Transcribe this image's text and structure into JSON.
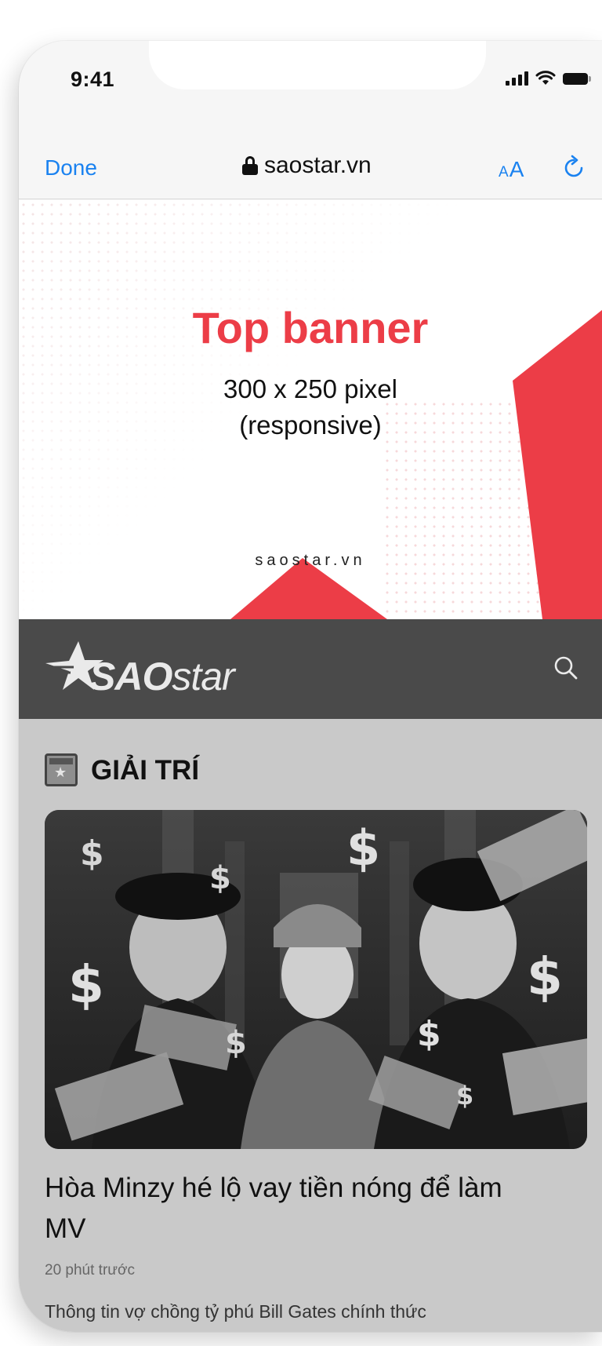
{
  "status_bar": {
    "time": "9:41"
  },
  "browser": {
    "done_label": "Done",
    "url": "saostar.vn",
    "text_size_small": "A",
    "text_size_large": "A"
  },
  "banner": {
    "title": "Top banner",
    "size_line": "300 x 250 pixel",
    "responsive_line": "(responsive)",
    "site": "saostar.vn",
    "accent_color": "#ec3d47"
  },
  "site_header": {
    "logo_bold": "SAO",
    "logo_light": "star",
    "background_color": "#4a4a4a"
  },
  "section": {
    "title": "GIẢI TRÍ"
  },
  "article": {
    "title": "Hòa Minzy hé lộ vay tiền nóng để làm MV",
    "time": "20 phút trước",
    "snippet": "Thông tin vợ chồng tỷ phú Bill Gates chính thức"
  },
  "icons": [
    "lock-icon",
    "text-size-icon",
    "reload-icon",
    "star-icon",
    "search-icon",
    "section-icon"
  ]
}
